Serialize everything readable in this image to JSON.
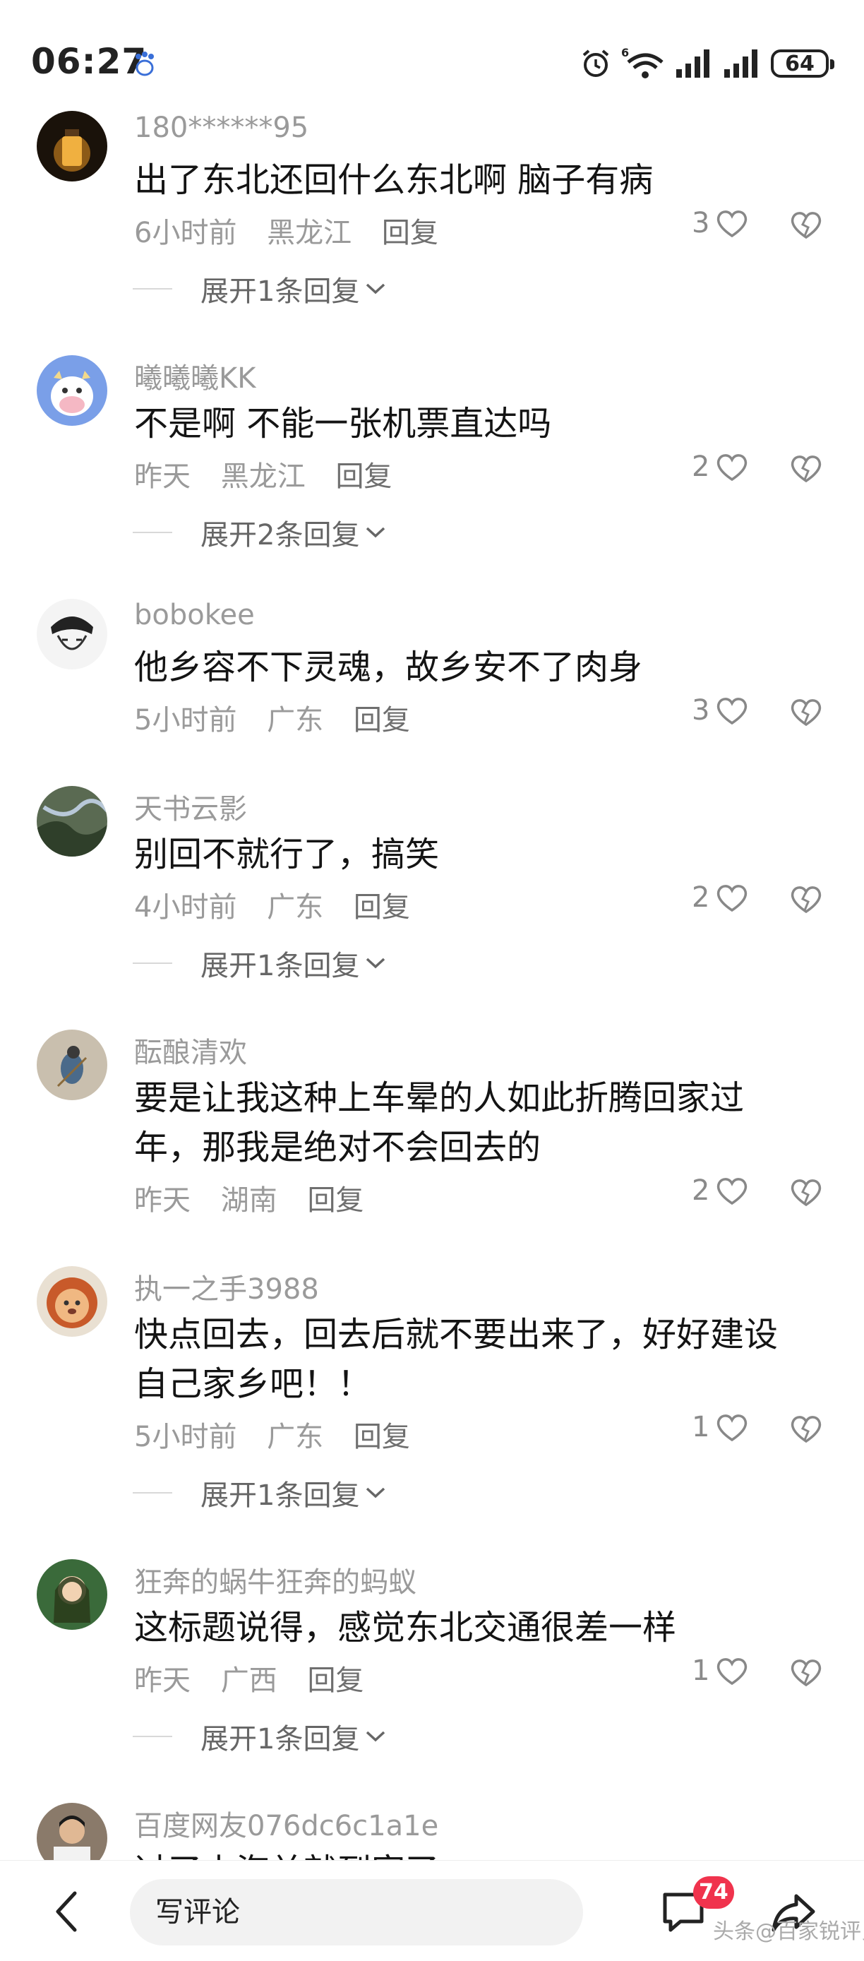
{
  "status": {
    "time": "06:27",
    "battery": "64",
    "signal_badge": "6"
  },
  "comments": [
    {
      "user": "180******95",
      "text": "出了东北还回什么东北啊 脑子有病",
      "time": "6小时前",
      "location": "黑龙江",
      "reply": "回复",
      "likes": "3",
      "expand": "展开1条回复"
    },
    {
      "user": "曦曦曦KK",
      "text": "不是啊 不能一张机票直达吗",
      "time": "昨天",
      "location": "黑龙江",
      "reply": "回复",
      "likes": "2",
      "expand": "展开2条回复"
    },
    {
      "user": "bobokee",
      "text": "他乡容不下灵魂，故乡安不了肉身",
      "time": "5小时前",
      "location": "广东",
      "reply": "回复",
      "likes": "3"
    },
    {
      "user": "天书云影",
      "text": "别回不就行了，搞笑",
      "time": "4小时前",
      "location": "广东",
      "reply": "回复",
      "likes": "2",
      "expand": "展开1条回复"
    },
    {
      "user": "酝酿清欢",
      "text_line1": "要是让我这种上车晕的人如此折腾回家过",
      "text_line2": "年，那我是绝对不会回去的",
      "time": "昨天",
      "location": "湖南",
      "reply": "回复",
      "likes": "2"
    },
    {
      "user": "执一之手3988",
      "text_line1": "快点回去，回去后就不要出来了，好好建设",
      "text_line2": "自己家乡吧！！",
      "time": "5小时前",
      "location": "广东",
      "reply": "回复",
      "likes": "1",
      "expand": "展开1条回复"
    },
    {
      "user": "狂奔的蜗牛狂奔的蚂蚁",
      "text": "这标题说得，感觉东北交通很差一样",
      "time": "昨天",
      "location": "广西",
      "reply": "回复",
      "likes": "1",
      "expand": "展开1条回复"
    },
    {
      "user": "百度网友076dc6c1a1e",
      "text": "过了山海关就到家了"
    }
  ],
  "bottom": {
    "input_placeholder": "写评论",
    "comment_count": "74",
    "watermark": "头条@百家锐评员"
  },
  "colors": {
    "badge": "#f0334d",
    "muted_text": "#9a9a9a"
  }
}
